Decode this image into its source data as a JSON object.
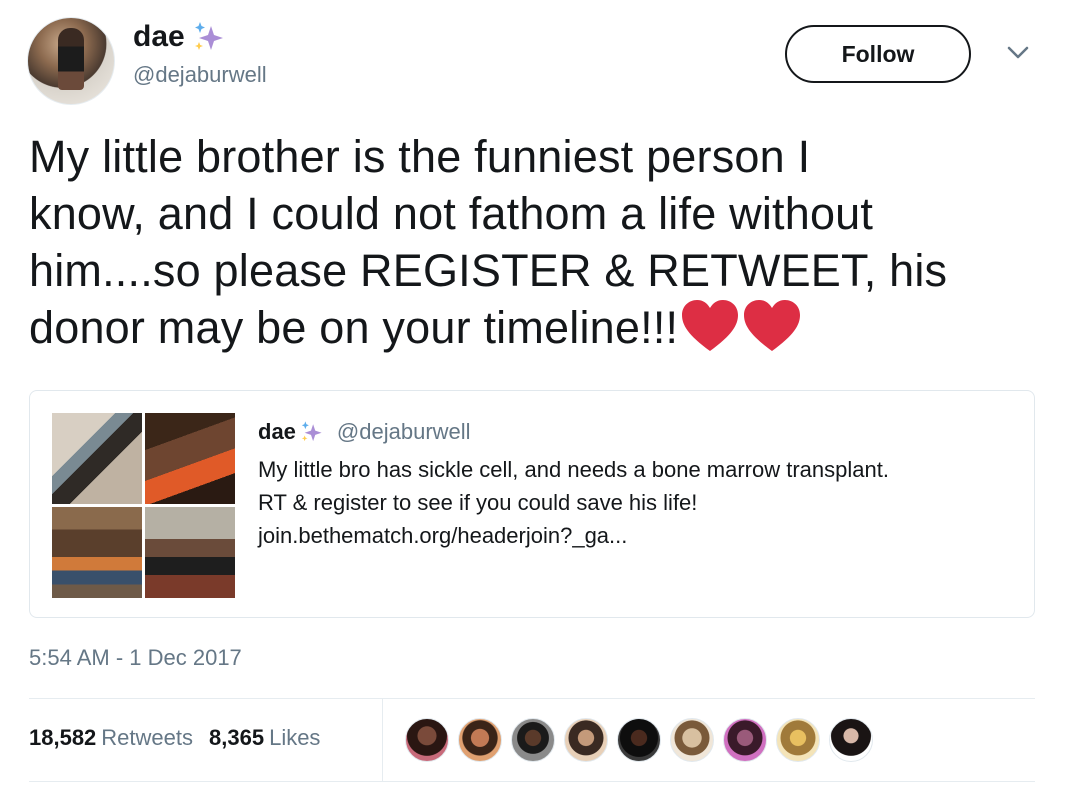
{
  "tweet": {
    "author": {
      "display_name": "dae",
      "name_emoji": "sparkles-icon",
      "handle": "@dejaburwell"
    },
    "follow_label": "Follow",
    "text_lines": [
      "My little brother is the funniest person I",
      "know, and I could not fathom a life without",
      "him....so please REGISTER & RETWEET, his",
      "donor may be on your timeline!!!"
    ],
    "trailing_emoji": [
      "red-heart-icon",
      "red-heart-icon"
    ],
    "timestamp": "5:54 AM - 1 Dec 2017"
  },
  "quoted_tweet": {
    "display_name": "dae",
    "handle": "@dejaburwell",
    "text_lines": [
      "My little bro has sickle cell, and needs a bone marrow transplant.",
      "RT & register to see if you could save his life!",
      "join.bethematch.org/headerjoin?_ga..."
    ],
    "media_count": 4
  },
  "stats": {
    "retweets_count": "18,582",
    "retweets_label": "Retweets",
    "likes_count": "8,365",
    "likes_label": "Likes"
  },
  "liker_avatars_count": 9,
  "colors": {
    "text": "#14171a",
    "secondary": "#657786",
    "border": "#e1e8ed",
    "heart": "#e0245e",
    "sparkle": "#aa8ed6"
  }
}
